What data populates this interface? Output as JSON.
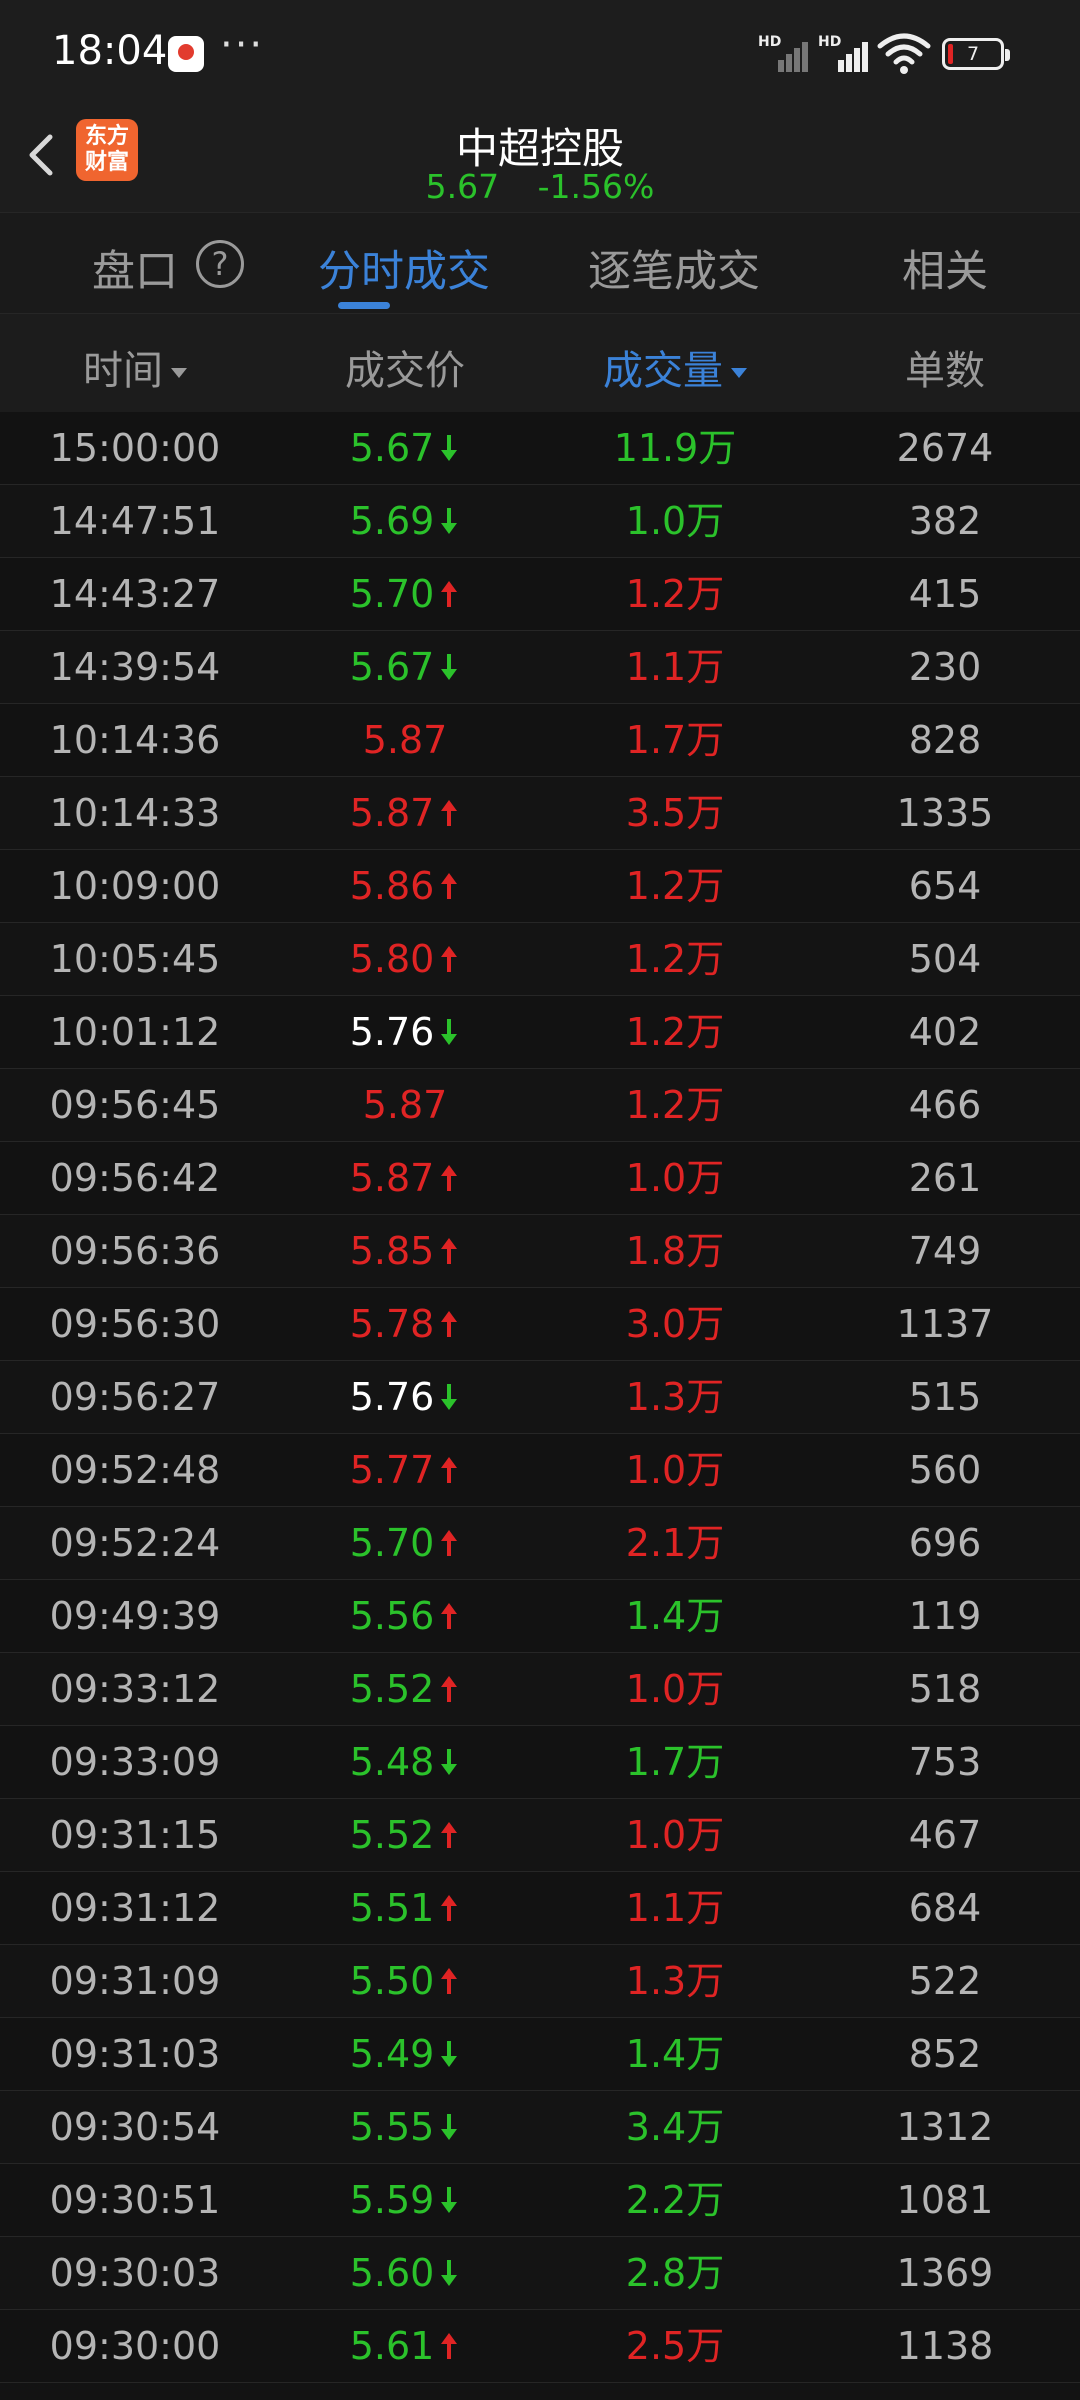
{
  "status_bar": {
    "time": "18:04",
    "more": "···",
    "signal_label_1": "HD",
    "signal_label_2": "HD",
    "battery": "7"
  },
  "header": {
    "logo_line1": "东方",
    "logo_line2": "财富",
    "stock_name": "中超控股",
    "price": "5.67",
    "change_pct": "-1.56%"
  },
  "tabs": [
    {
      "label": "盘口",
      "active": false
    },
    {
      "label": "分时成交",
      "active": true
    },
    {
      "label": "逐笔成交",
      "active": false
    },
    {
      "label": "相关",
      "active": false
    }
  ],
  "help": "?",
  "columns": [
    "时间",
    "成交价",
    "成交量",
    "单数"
  ],
  "colors": {
    "up": "#e02424",
    "down": "#2bc22b",
    "neutral": "#ffffff",
    "accent": "#3b82d8"
  },
  "rows": [
    {
      "time": "15:00:00",
      "price": "5.67",
      "price_color": "green",
      "dir": "down",
      "vol": "11.9万",
      "vol_color": "green",
      "count": "2674"
    },
    {
      "time": "14:47:51",
      "price": "5.69",
      "price_color": "green",
      "dir": "down",
      "vol": "1.0万",
      "vol_color": "green",
      "count": "382"
    },
    {
      "time": "14:43:27",
      "price": "5.70",
      "price_color": "green",
      "dir": "up",
      "vol": "1.2万",
      "vol_color": "red",
      "count": "415"
    },
    {
      "time": "14:39:54",
      "price": "5.67",
      "price_color": "green",
      "dir": "down",
      "vol": "1.1万",
      "vol_color": "red",
      "count": "230"
    },
    {
      "time": "10:14:36",
      "price": "5.87",
      "price_color": "red",
      "dir": "none",
      "vol": "1.7万",
      "vol_color": "red",
      "count": "828"
    },
    {
      "time": "10:14:33",
      "price": "5.87",
      "price_color": "red",
      "dir": "up",
      "vol": "3.5万",
      "vol_color": "red",
      "count": "1335"
    },
    {
      "time": "10:09:00",
      "price": "5.86",
      "price_color": "red",
      "dir": "up",
      "vol": "1.2万",
      "vol_color": "red",
      "count": "654"
    },
    {
      "time": "10:05:45",
      "price": "5.80",
      "price_color": "red",
      "dir": "up",
      "vol": "1.2万",
      "vol_color": "red",
      "count": "504"
    },
    {
      "time": "10:01:12",
      "price": "5.76",
      "price_color": "white",
      "dir": "down",
      "vol": "1.2万",
      "vol_color": "red",
      "count": "402"
    },
    {
      "time": "09:56:45",
      "price": "5.87",
      "price_color": "red",
      "dir": "none",
      "vol": "1.2万",
      "vol_color": "red",
      "count": "466"
    },
    {
      "time": "09:56:42",
      "price": "5.87",
      "price_color": "red",
      "dir": "up",
      "vol": "1.0万",
      "vol_color": "red",
      "count": "261"
    },
    {
      "time": "09:56:36",
      "price": "5.85",
      "price_color": "red",
      "dir": "up",
      "vol": "1.8万",
      "vol_color": "red",
      "count": "749"
    },
    {
      "time": "09:56:30",
      "price": "5.78",
      "price_color": "red",
      "dir": "up",
      "vol": "3.0万",
      "vol_color": "red",
      "count": "1137"
    },
    {
      "time": "09:56:27",
      "price": "5.76",
      "price_color": "white",
      "dir": "down",
      "vol": "1.3万",
      "vol_color": "red",
      "count": "515"
    },
    {
      "time": "09:52:48",
      "price": "5.77",
      "price_color": "red",
      "dir": "up",
      "vol": "1.0万",
      "vol_color": "red",
      "count": "560"
    },
    {
      "time": "09:52:24",
      "price": "5.70",
      "price_color": "green",
      "dir": "up",
      "vol": "2.1万",
      "vol_color": "red",
      "count": "696"
    },
    {
      "time": "09:49:39",
      "price": "5.56",
      "price_color": "green",
      "dir": "up",
      "vol": "1.4万",
      "vol_color": "green",
      "count": "119"
    },
    {
      "time": "09:33:12",
      "price": "5.52",
      "price_color": "green",
      "dir": "up",
      "vol": "1.0万",
      "vol_color": "red",
      "count": "518"
    },
    {
      "time": "09:33:09",
      "price": "5.48",
      "price_color": "green",
      "dir": "down",
      "vol": "1.7万",
      "vol_color": "green",
      "count": "753"
    },
    {
      "time": "09:31:15",
      "price": "5.52",
      "price_color": "green",
      "dir": "up",
      "vol": "1.0万",
      "vol_color": "red",
      "count": "467"
    },
    {
      "time": "09:31:12",
      "price": "5.51",
      "price_color": "green",
      "dir": "up",
      "vol": "1.1万",
      "vol_color": "red",
      "count": "684"
    },
    {
      "time": "09:31:09",
      "price": "5.50",
      "price_color": "green",
      "dir": "up",
      "vol": "1.3万",
      "vol_color": "red",
      "count": "522"
    },
    {
      "time": "09:31:03",
      "price": "5.49",
      "price_color": "green",
      "dir": "down",
      "vol": "1.4万",
      "vol_color": "green",
      "count": "852"
    },
    {
      "time": "09:30:54",
      "price": "5.55",
      "price_color": "green",
      "dir": "down",
      "vol": "3.4万",
      "vol_color": "green",
      "count": "1312"
    },
    {
      "time": "09:30:51",
      "price": "5.59",
      "price_color": "green",
      "dir": "down",
      "vol": "2.2万",
      "vol_color": "green",
      "count": "1081"
    },
    {
      "time": "09:30:03",
      "price": "5.60",
      "price_color": "green",
      "dir": "down",
      "vol": "2.8万",
      "vol_color": "green",
      "count": "1369"
    },
    {
      "time": "09:30:00",
      "price": "5.61",
      "price_color": "green",
      "dir": "up",
      "vol": "2.5万",
      "vol_color": "red",
      "count": "1138"
    }
  ]
}
